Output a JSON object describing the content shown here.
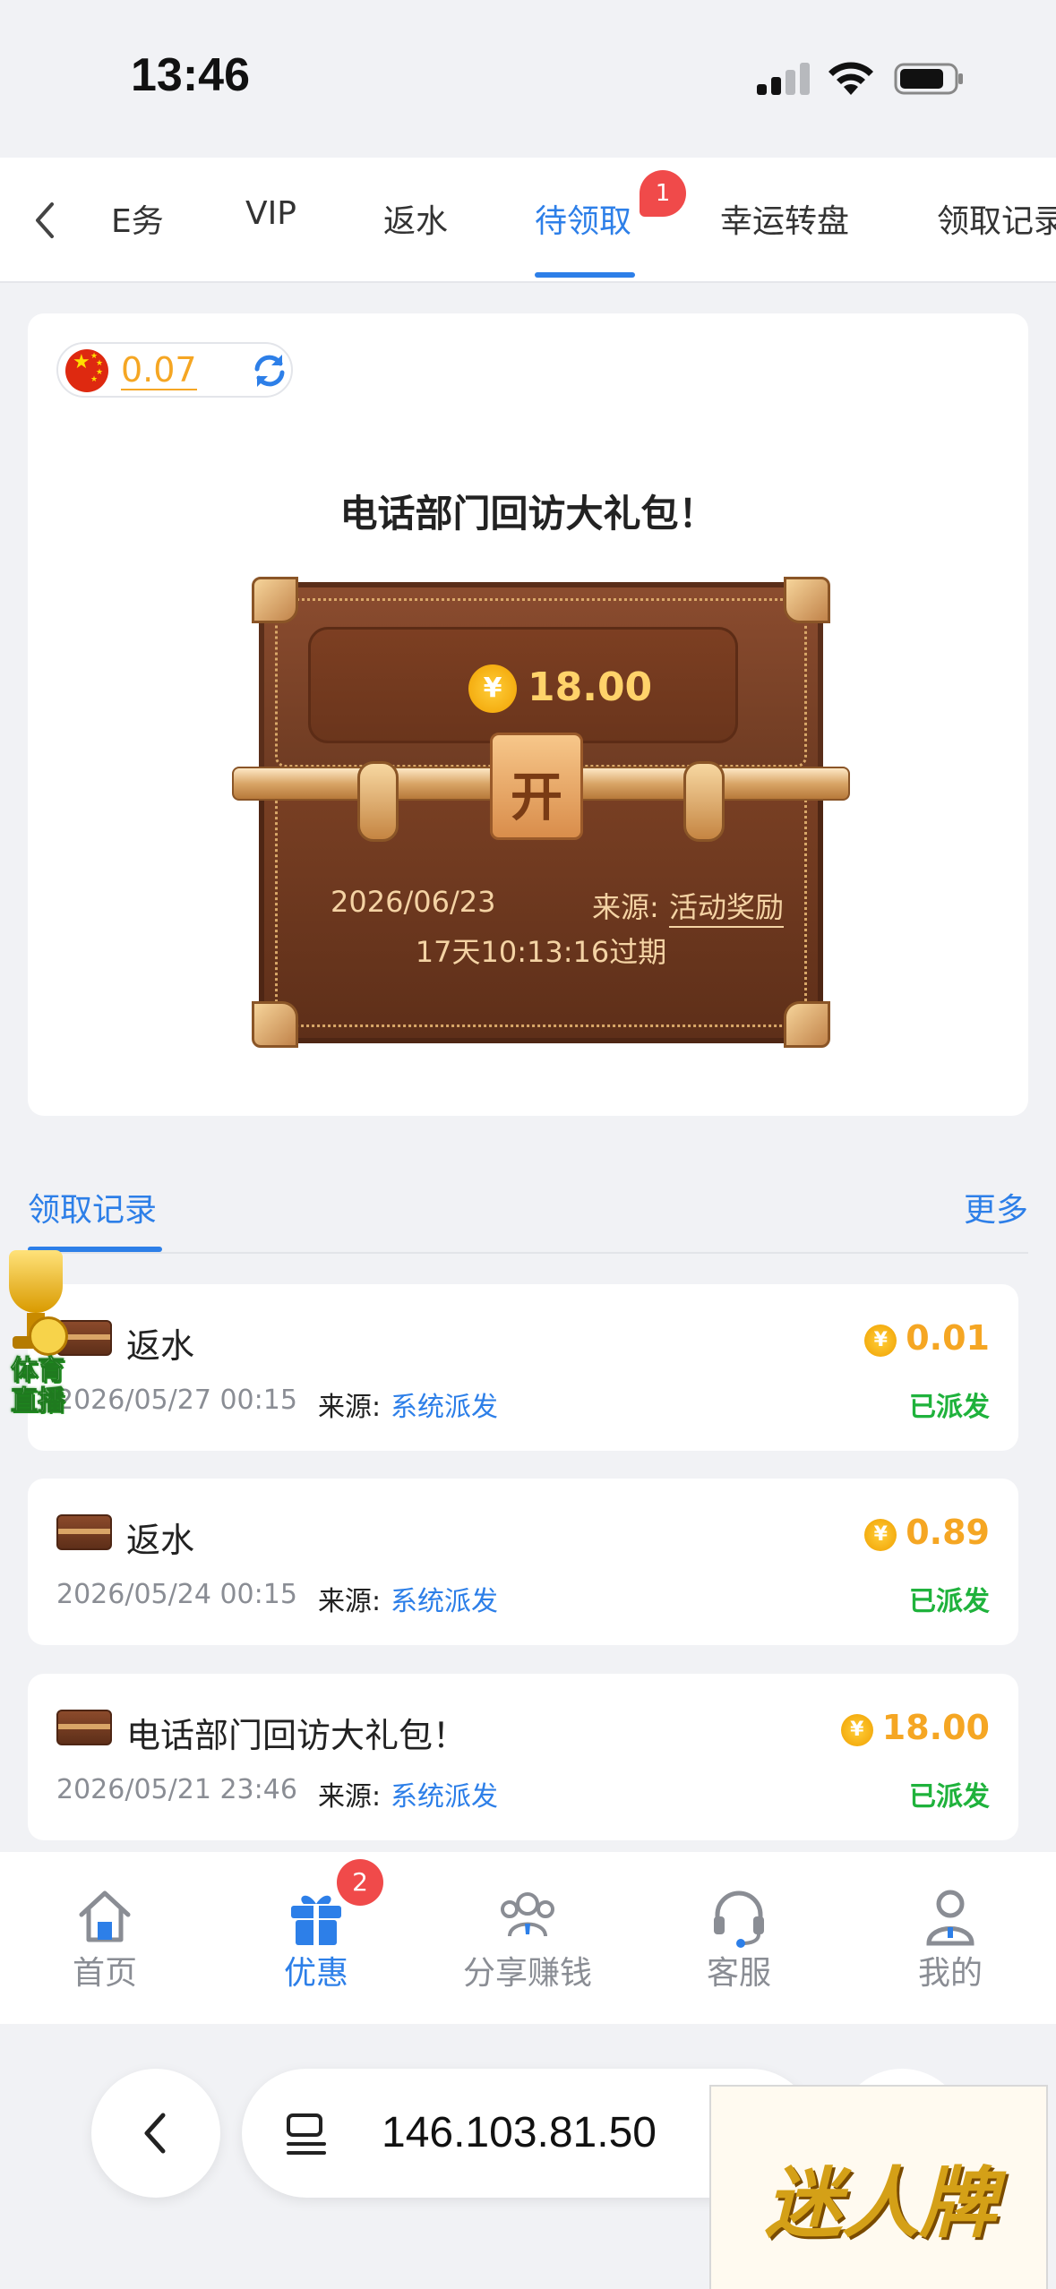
{
  "status_bar": {
    "time": "13:46"
  },
  "tabs": {
    "items": [
      {
        "label": "任务",
        "display": "E务"
      },
      {
        "label": "VIP"
      },
      {
        "label": "返水"
      },
      {
        "label": "待领取",
        "badge": "1"
      },
      {
        "label": "幸运转盘"
      },
      {
        "label": "领取记录"
      }
    ],
    "active": "待领取"
  },
  "balance": {
    "value": "0.07",
    "currency_flag": "china-flag"
  },
  "gift": {
    "title": "电话部门回访大礼包！",
    "amount": "18.00",
    "currency_symbol": "¥",
    "open_label": "开",
    "date": "2026/06/23",
    "source_label": "来源:",
    "source": "活动奖励",
    "expire": "17天10:13:16过期"
  },
  "records": {
    "title": "领取记录",
    "more": "更多",
    "items": [
      {
        "title": "返水",
        "date": "2026/05/27 00:15",
        "source_label": "来源:",
        "source": "系统派发",
        "amount": "0.01",
        "status": "已派发"
      },
      {
        "title": "返水",
        "date": "2026/05/24 00:15",
        "source_label": "来源:",
        "source": "系统派发",
        "amount": "0.89",
        "status": "已派发"
      },
      {
        "title": "电话部门回访大礼包！",
        "date": "2026/05/21 23:46",
        "source_label": "来源:",
        "source": "系统派发",
        "amount": "18.00",
        "status": "已派发"
      }
    ]
  },
  "floating": {
    "label_line1": "体育",
    "label_line2": "直播"
  },
  "bottom_nav": {
    "items": [
      {
        "label": "首页",
        "icon": "home-icon"
      },
      {
        "label": "优惠",
        "icon": "gift-icon",
        "badge": "2"
      },
      {
        "label": "分享赚钱",
        "icon": "share-users-icon"
      },
      {
        "label": "客服",
        "icon": "headset-icon"
      },
      {
        "label": "我的",
        "icon": "profile-icon"
      }
    ],
    "active": "优惠"
  },
  "browser": {
    "url": "146.103.81.50"
  },
  "watermark": {
    "text": "迷人牌"
  },
  "colors": {
    "accent": "#2d7fe8",
    "gold": "#f5a623",
    "success": "#1fb23c",
    "badge": "#f04a4a"
  }
}
